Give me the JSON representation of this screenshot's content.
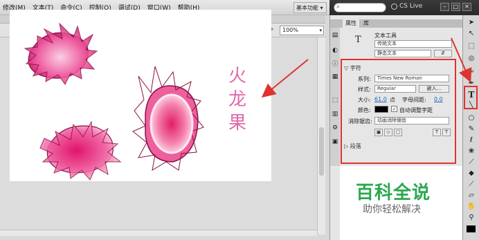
{
  "menubar": {
    "items": [
      "修改(M)",
      "文本(T)",
      "命令(C)",
      "控制(O)",
      "调试(D)",
      "窗口(W)",
      "帮助(H)"
    ],
    "workspace": "基本功能 ▾"
  },
  "topbar": {
    "cs_live": "CS Live"
  },
  "stage": {
    "zoom": "100%",
    "title_chars": [
      "火",
      "龙",
      "果"
    ]
  },
  "panel": {
    "tabs": [
      "属性",
      "库"
    ],
    "tool_name": "文本工具",
    "text_type": "传统文本",
    "text_subtype": "静态文本",
    "section_char": "字符",
    "family_label": "系列:",
    "family_value": "Times New Roman",
    "style_label": "样式:",
    "style_value": "Regular",
    "embed_label": "嵌入...",
    "size_label": "大小:",
    "size_value": "61.0",
    "size_unit": "点",
    "spacing_label": "字母间距:",
    "spacing_value": "0.0",
    "color_label": "颜色:",
    "auto_kern": "自动调整字距",
    "aa_label": "消除锯齿:",
    "aa_value": "动画消除锯齿",
    "section_para": "段落"
  },
  "watermark": {
    "title": "百科全说",
    "subtitle": "助你轻松解决"
  },
  "colors": {
    "accent_red": "#e0322f",
    "fruit_pink": "#e85b9b",
    "watermark_green": "#2aa84f"
  }
}
